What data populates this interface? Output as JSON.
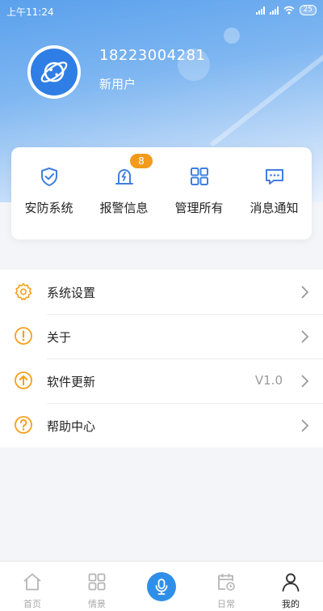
{
  "status": {
    "time": "上午11:24",
    "battery": "25"
  },
  "profile": {
    "phone": "18223004281",
    "name": "新用户"
  },
  "quick_actions": [
    {
      "label": "安防系统",
      "icon": "shield-check-icon"
    },
    {
      "label": "报警信息",
      "icon": "alarm-light-icon",
      "badge": "8"
    },
    {
      "label": "管理所有",
      "icon": "grid-icon"
    },
    {
      "label": "消息通知",
      "icon": "message-icon"
    }
  ],
  "menu": [
    {
      "label": "系统设置",
      "icon": "gear-icon",
      "value": ""
    },
    {
      "label": "关于",
      "icon": "exclamation-circle-icon",
      "value": ""
    },
    {
      "label": "软件更新",
      "icon": "arrow-up-circle-icon",
      "value": "V1.0"
    },
    {
      "label": "帮助中心",
      "icon": "question-circle-icon",
      "value": ""
    }
  ],
  "tabs": [
    {
      "label": "首页",
      "icon": "home-icon"
    },
    {
      "label": "情景",
      "icon": "grid-icon"
    },
    {
      "label": "",
      "icon": "microphone-icon"
    },
    {
      "label": "日常",
      "icon": "calendar-clock-icon"
    },
    {
      "label": "我的",
      "icon": "person-icon",
      "active": true
    }
  ],
  "colors": {
    "accent": "#2f8fe8",
    "menu_icon": "#f5a01d",
    "badge": "#f39a1a",
    "quick_icon": "#3f7fe0"
  }
}
